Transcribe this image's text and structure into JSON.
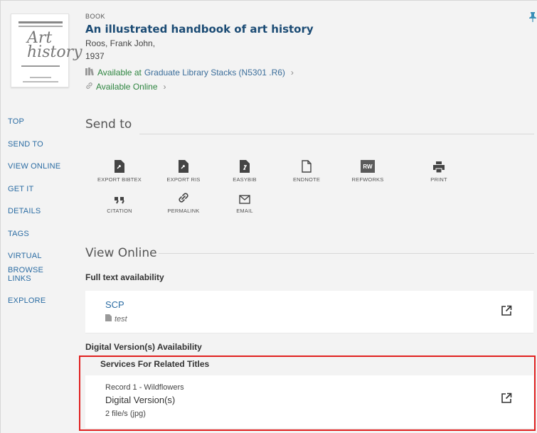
{
  "record": {
    "type": "BOOK",
    "title": "An illustrated handbook of art history",
    "author": "Roos, Frank John,",
    "year": "1937",
    "availability_status": "Available at",
    "availability_location": "Graduate Library  Stacks (N5301 .R6)",
    "online_status": "Available Online"
  },
  "nav": [
    "TOP",
    "SEND TO",
    "VIEW ONLINE",
    "GET IT",
    "DETAILS",
    "TAGS",
    "VIRTUAL BROWSE",
    "LINKS",
    "EXPLORE"
  ],
  "send_to": {
    "heading": "Send to",
    "actions": [
      {
        "label": "EXPORT BIBTEX",
        "icon": "file-export-icon"
      },
      {
        "label": "EXPORT RIS",
        "icon": "file-export-icon"
      },
      {
        "label": "EASYBIB",
        "icon": "file-easybib-icon"
      },
      {
        "label": "ENDNOTE",
        "icon": "file-outline-icon"
      },
      {
        "label": "REFWORKS",
        "icon": "refworks-icon",
        "badge": "RW"
      },
      {
        "label": "PRINT",
        "icon": "printer-icon"
      },
      {
        "label": "CITATION",
        "icon": "quote-icon"
      },
      {
        "label": "PERMALINK",
        "icon": "link-icon"
      },
      {
        "label": "EMAIL",
        "icon": "envelope-icon"
      }
    ]
  },
  "view_online": {
    "heading": "View Online",
    "full_text_heading": "Full text availability",
    "service": {
      "name": "SCP",
      "note": "test"
    },
    "digital_heading": "Digital Version(s) Availability",
    "related_heading": "Services For Related Titles",
    "related": {
      "record": "Record 1 - Wildflowers",
      "title": "Digital Version(s)",
      "files": "2 file/s (jpg)"
    }
  },
  "colors": {
    "link": "#2b6ca3",
    "available": "#2e8540",
    "highlight": "#e0201f"
  }
}
